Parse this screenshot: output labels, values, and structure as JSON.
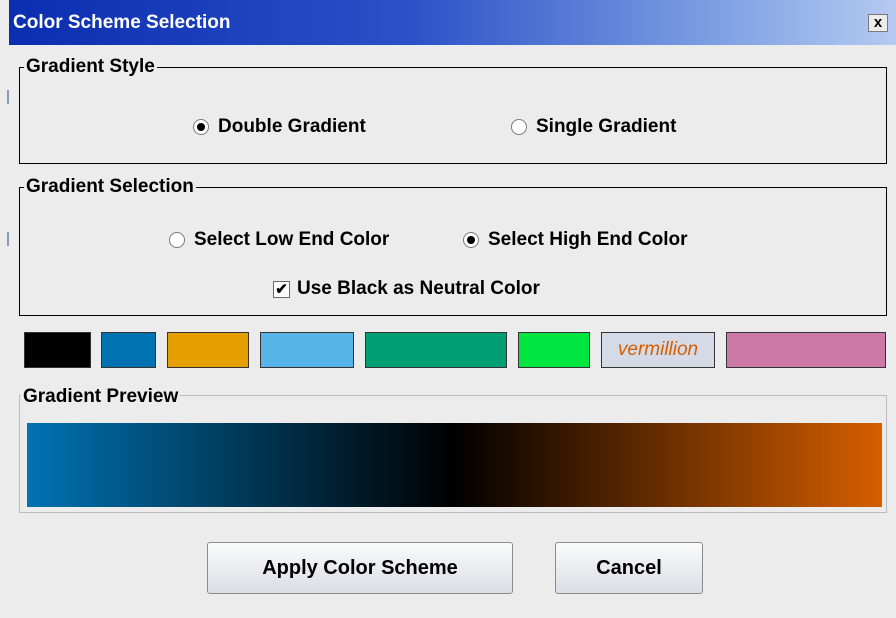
{
  "window": {
    "title": "Color Scheme Selection",
    "close_glyph": "x"
  },
  "gradient_style": {
    "legend": "Gradient Style",
    "options": [
      {
        "label": "Double Gradient",
        "selected": true
      },
      {
        "label": "Single Gradient",
        "selected": false
      }
    ]
  },
  "gradient_selection": {
    "legend": "Gradient Selection",
    "options": [
      {
        "label": "Select Low End Color",
        "selected": false
      },
      {
        "label": "Select High End Color",
        "selected": true
      }
    ],
    "neutral_checkbox": {
      "label": "Use Black as Neutral Color",
      "checked": true,
      "check_glyph": "✔"
    }
  },
  "swatches": [
    {
      "name": "black",
      "color": "#000000"
    },
    {
      "name": "blue",
      "color": "#0072b2"
    },
    {
      "name": "orange",
      "color": "#e69f00"
    },
    {
      "name": "sky-blue",
      "color": "#56b4e9"
    },
    {
      "name": "bluish-green",
      "color": "#009e73"
    },
    {
      "name": "green",
      "color": "#00e640"
    },
    {
      "name": "vermillion",
      "color": "#d5dbe6",
      "label": "vermillion",
      "label_color": "#d55e00"
    },
    {
      "name": "reddish-purple",
      "color": "#cc79a7"
    }
  ],
  "preview": {
    "legend": "Gradient Preview",
    "low_color": "#0072b2",
    "neutral_color": "#000000",
    "high_color": "#d55e00"
  },
  "buttons": {
    "apply": "Apply Color Scheme",
    "cancel": "Cancel"
  }
}
